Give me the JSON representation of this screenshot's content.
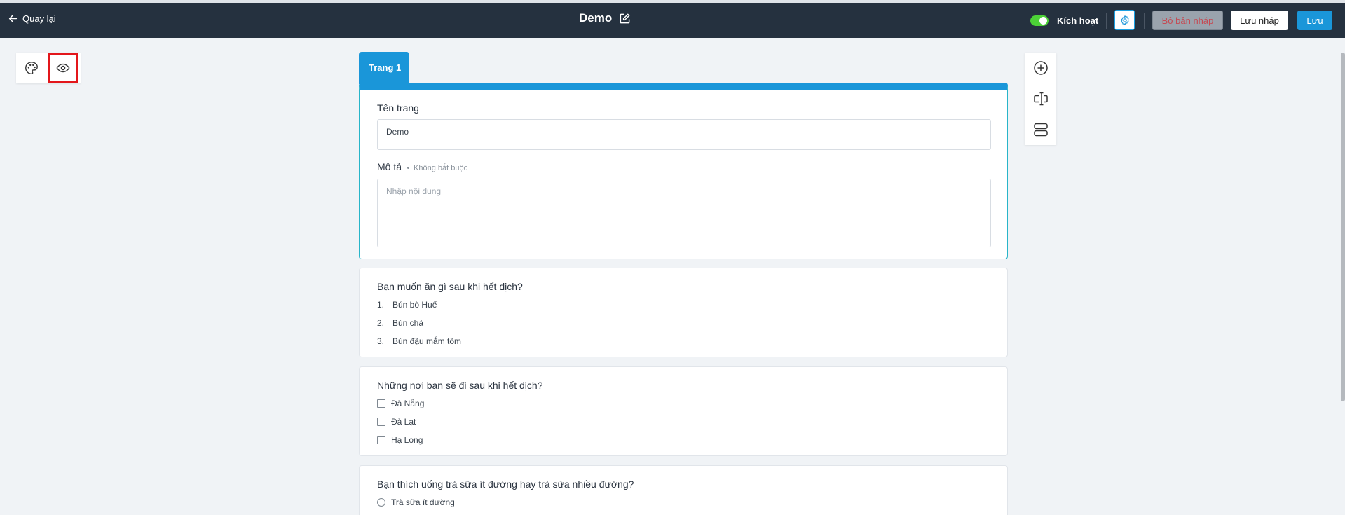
{
  "header": {
    "back_label": "Quay lại",
    "title": "Demo",
    "active_label": "Kích hoạt",
    "active": true,
    "discard_draft_label": "Bỏ bản nháp",
    "save_draft_label": "Lưu nháp",
    "save_label": "Lưu"
  },
  "colors": {
    "topbar_bg": "#25313f",
    "accent": "#1a96d9",
    "toggle_on": "#4cd137",
    "highlight_box": "#e3161b"
  },
  "left_tools": [
    "palette-icon",
    "eye-icon"
  ],
  "right_tools": [
    "add-circle-icon",
    "text-cursor-icon",
    "section-icon"
  ],
  "page": {
    "tab_label": "Trang 1",
    "name_label": "Tên trang",
    "name_value": "Demo",
    "desc_label": "Mô tả",
    "desc_optional": "Không bắt buộc",
    "desc_placeholder": "Nhập nội dung"
  },
  "questions": [
    {
      "title": "Bạn muốn ăn gì sau khi hết dịch?",
      "type": "ordered",
      "options": [
        "Bún bò Huế",
        "Bún chả",
        "Bún đậu mắm tôm"
      ],
      "numbers": [
        "1.",
        "2.",
        "3."
      ]
    },
    {
      "title": "Những nơi bạn sẽ đi sau khi hết dịch?",
      "type": "checkbox",
      "options": [
        "Đà Nẵng",
        "Đà Lạt",
        "Hạ Long"
      ]
    },
    {
      "title": "Bạn thích uống trà sữa ít đường hay trà sữa nhiều đường?",
      "type": "radio",
      "options": [
        "Trà sữa ít đường"
      ]
    }
  ]
}
